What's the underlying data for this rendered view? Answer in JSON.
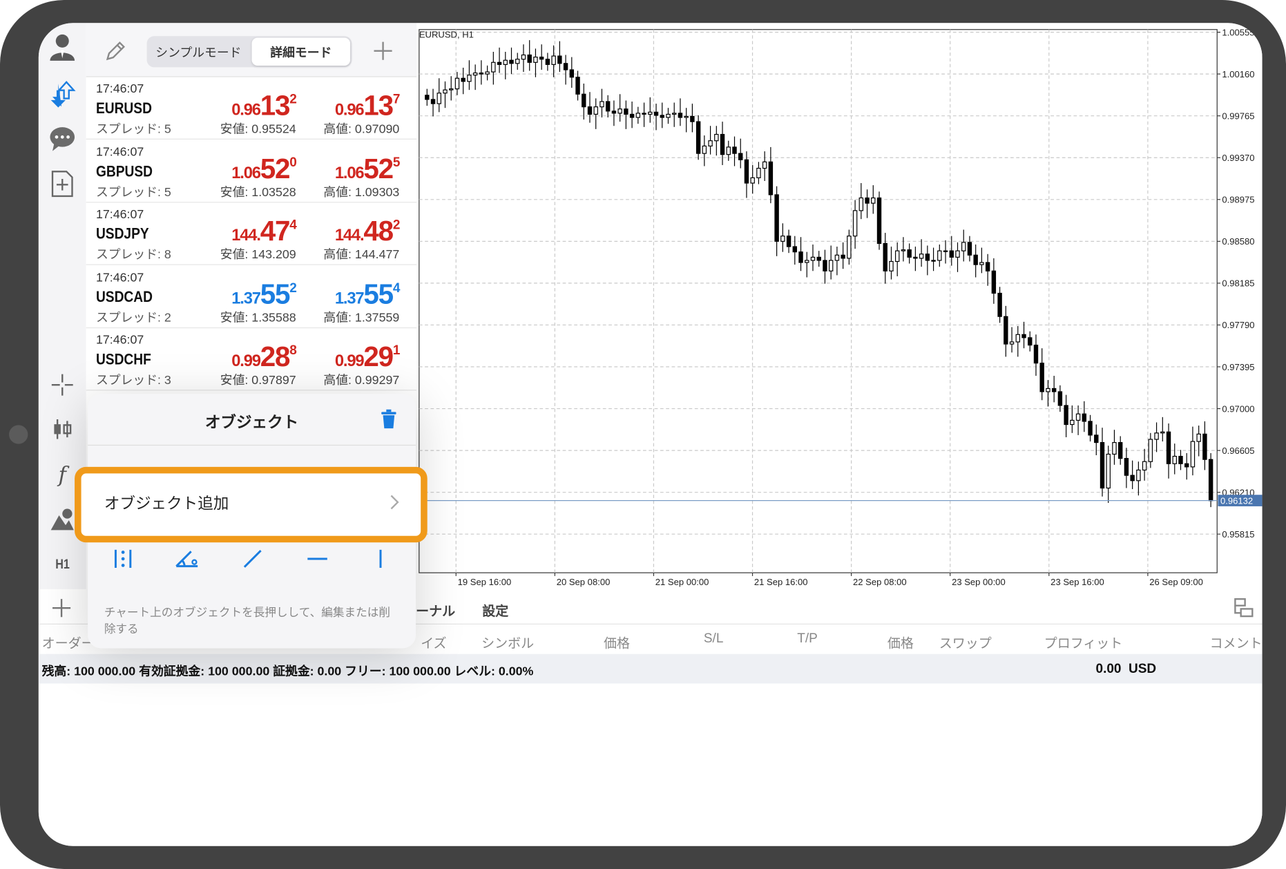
{
  "header": {
    "simple_mode": "シンプルモード",
    "detail_mode": "詳細モード"
  },
  "quotes": [
    {
      "time": "17:46:07",
      "symbol": "EURUSD",
      "spread": "スプレッド: 5",
      "bid_small": "0.96",
      "bid_big": "13",
      "bid_sup": "2",
      "ask_small": "0.96",
      "ask_big": "13",
      "ask_sup": "7",
      "low": "安値: 0.95524",
      "high": "高値: 0.97090",
      "color": "#d0261f"
    },
    {
      "time": "17:46:07",
      "symbol": "GBPUSD",
      "spread": "スプレッド: 5",
      "bid_small": "1.06",
      "bid_big": "52",
      "bid_sup": "0",
      "ask_small": "1.06",
      "ask_big": "52",
      "ask_sup": "5",
      "low": "安値: 1.03528",
      "high": "高値: 1.09303",
      "color": "#d0261f"
    },
    {
      "time": "17:46:07",
      "symbol": "USDJPY",
      "spread": "スプレッド: 8",
      "bid_small": "144.",
      "bid_big": "47",
      "bid_sup": "4",
      "ask_small": "144.",
      "ask_big": "48",
      "ask_sup": "2",
      "low": "安値: 143.209",
      "high": "高値: 144.477",
      "color": "#d0261f"
    },
    {
      "time": "17:46:07",
      "symbol": "USDCAD",
      "spread": "スプレッド: 2",
      "bid_small": "1.37",
      "bid_big": "55",
      "bid_sup": "2",
      "ask_small": "1.37",
      "ask_big": "55",
      "ask_sup": "4",
      "low": "安値: 1.35588",
      "high": "高値: 1.37559",
      "color": "#1a7de0"
    },
    {
      "time": "17:46:07",
      "symbol": "USDCHF",
      "spread": "スプレッド: 3",
      "bid_small": "0.99",
      "bid_big": "28",
      "bid_sup": "8",
      "ask_small": "0.99",
      "ask_big": "29",
      "ask_sup": "1",
      "low": "安値: 0.97897",
      "high": "高値: 0.99297",
      "color": "#d0261f"
    }
  ],
  "sidebar": {
    "timeframe": "H1"
  },
  "chart": {
    "title": "EURUSD, H1",
    "current_price_label": "0.96132"
  },
  "chart_data": {
    "type": "candlestick",
    "title": "EURUSD, H1",
    "current_price": 0.96132,
    "y_ticks": [
      "1.00555",
      "1.00160",
      "0.99765",
      "0.99370",
      "0.98975",
      "0.98580",
      "0.98185",
      "0.97790",
      "0.97395",
      "0.97000",
      "0.96605",
      "0.96210",
      "0.95815"
    ],
    "x_ticks": [
      "19 Sep 16:00",
      "20 Sep 08:00",
      "21 Sep 00:00",
      "21 Sep 16:00",
      "22 Sep 08:00",
      "23 Sep 00:00",
      "23 Sep 16:00",
      "26 Sep 09:00"
    ],
    "ylim": [
      0.9545,
      1.0058
    ],
    "grid": true,
    "closes": [
      0.9992,
      0.9988,
      0.9998,
      1.0001,
      1.0002,
      1.0012,
      1.0009,
      1.0015,
      1.0017,
      1.0016,
      1.0018,
      1.0027,
      1.0025,
      1.0029,
      1.0026,
      1.003,
      1.0034,
      1.0027,
      1.0032,
      1.003,
      1.0025,
      1.0033,
      1.0026,
      1.002,
      1.0013,
      0.9997,
      0.9985,
      0.9978,
      0.9985,
      0.999,
      0.9981,
      0.9979,
      0.9983,
      0.9978,
      0.9975,
      0.9979,
      0.9978,
      0.998,
      0.9977,
      0.9975,
      0.9978,
      0.9979,
      0.9975,
      0.9976,
      0.9971,
      0.9941,
      0.9948,
      0.9953,
      0.9959,
      0.994,
      0.9947,
      0.9941,
      0.9935,
      0.9913,
      0.9918,
      0.9927,
      0.9933,
      0.9902,
      0.9858,
      0.9863,
      0.9853,
      0.9848,
      0.9838,
      0.984,
      0.9843,
      0.984,
      0.983,
      0.984,
      0.9845,
      0.9842,
      0.9863,
      0.9887,
      0.9899,
      0.9894,
      0.9899,
      0.9856,
      0.983,
      0.9839,
      0.9849,
      0.985,
      0.9843,
      0.9842,
      0.9846,
      0.984,
      0.984,
      0.9849,
      0.9849,
      0.9843,
      0.9849,
      0.9857,
      0.9845,
      0.9836,
      0.9838,
      0.983,
      0.9809,
      0.9787,
      0.9761,
      0.9763,
      0.977,
      0.9767,
      0.976,
      0.9743,
      0.9716,
      0.9719,
      0.9716,
      0.9703,
      0.9685,
      0.9689,
      0.9695,
      0.9688,
      0.9675,
      0.9668,
      0.9625,
      0.9657,
      0.9668,
      0.9653,
      0.9637,
      0.9632,
      0.9642,
      0.965,
      0.9671,
      0.9677,
      0.9678,
      0.9648,
      0.9655,
      0.9648,
      0.9645,
      0.9669,
      0.9676,
      0.9652,
      0.9613
    ]
  },
  "popover": {
    "title": "オブジェクト",
    "add_object": "オブジェクト追加",
    "hint": "チャート上のオブジェクトを長押しして、編集または削除する"
  },
  "bottom": {
    "tabs_visible": [
      "ーナル",
      "設定"
    ],
    "columns": [
      "オーダー",
      "イズ",
      "シンボル",
      "価格",
      "S/L",
      "T/P",
      "価格",
      "スワップ",
      "プロフィット",
      "コメント"
    ],
    "status_text": "残高: 100 000.00 有効証拠金: 100 000.00 証拠金: 0.00 フリー: 100 000.00 レベル: 0.00%",
    "profit": "0.00  USD"
  },
  "colors": {
    "bid_red": "#d0261f",
    "bid_blue": "#1a7de0",
    "highlight": "#f09a1a",
    "accent": "#1a7de0"
  }
}
